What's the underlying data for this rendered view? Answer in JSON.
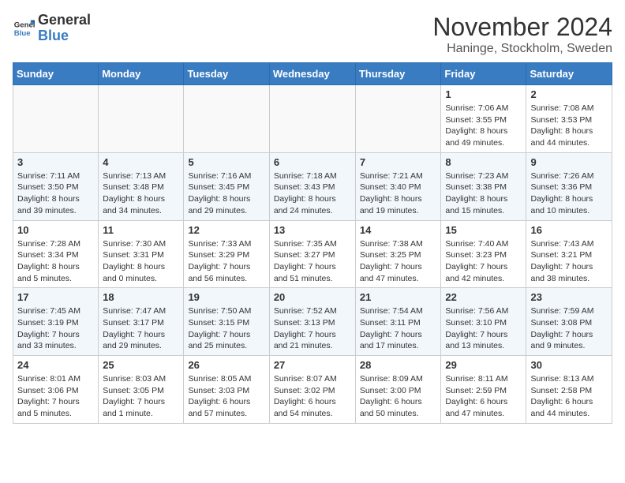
{
  "header": {
    "logo_general": "General",
    "logo_blue": "Blue",
    "month_title": "November 2024",
    "location": "Haninge, Stockholm, Sweden"
  },
  "weekdays": [
    "Sunday",
    "Monday",
    "Tuesday",
    "Wednesday",
    "Thursday",
    "Friday",
    "Saturday"
  ],
  "weeks": [
    {
      "days": [
        {
          "num": "",
          "info": ""
        },
        {
          "num": "",
          "info": ""
        },
        {
          "num": "",
          "info": ""
        },
        {
          "num": "",
          "info": ""
        },
        {
          "num": "",
          "info": ""
        },
        {
          "num": "1",
          "info": "Sunrise: 7:06 AM\nSunset: 3:55 PM\nDaylight: 8 hours and 49 minutes."
        },
        {
          "num": "2",
          "info": "Sunrise: 7:08 AM\nSunset: 3:53 PM\nDaylight: 8 hours and 44 minutes."
        }
      ]
    },
    {
      "days": [
        {
          "num": "3",
          "info": "Sunrise: 7:11 AM\nSunset: 3:50 PM\nDaylight: 8 hours and 39 minutes."
        },
        {
          "num": "4",
          "info": "Sunrise: 7:13 AM\nSunset: 3:48 PM\nDaylight: 8 hours and 34 minutes."
        },
        {
          "num": "5",
          "info": "Sunrise: 7:16 AM\nSunset: 3:45 PM\nDaylight: 8 hours and 29 minutes."
        },
        {
          "num": "6",
          "info": "Sunrise: 7:18 AM\nSunset: 3:43 PM\nDaylight: 8 hours and 24 minutes."
        },
        {
          "num": "7",
          "info": "Sunrise: 7:21 AM\nSunset: 3:40 PM\nDaylight: 8 hours and 19 minutes."
        },
        {
          "num": "8",
          "info": "Sunrise: 7:23 AM\nSunset: 3:38 PM\nDaylight: 8 hours and 15 minutes."
        },
        {
          "num": "9",
          "info": "Sunrise: 7:26 AM\nSunset: 3:36 PM\nDaylight: 8 hours and 10 minutes."
        }
      ]
    },
    {
      "days": [
        {
          "num": "10",
          "info": "Sunrise: 7:28 AM\nSunset: 3:34 PM\nDaylight: 8 hours and 5 minutes."
        },
        {
          "num": "11",
          "info": "Sunrise: 7:30 AM\nSunset: 3:31 PM\nDaylight: 8 hours and 0 minutes."
        },
        {
          "num": "12",
          "info": "Sunrise: 7:33 AM\nSunset: 3:29 PM\nDaylight: 7 hours and 56 minutes."
        },
        {
          "num": "13",
          "info": "Sunrise: 7:35 AM\nSunset: 3:27 PM\nDaylight: 7 hours and 51 minutes."
        },
        {
          "num": "14",
          "info": "Sunrise: 7:38 AM\nSunset: 3:25 PM\nDaylight: 7 hours and 47 minutes."
        },
        {
          "num": "15",
          "info": "Sunrise: 7:40 AM\nSunset: 3:23 PM\nDaylight: 7 hours and 42 minutes."
        },
        {
          "num": "16",
          "info": "Sunrise: 7:43 AM\nSunset: 3:21 PM\nDaylight: 7 hours and 38 minutes."
        }
      ]
    },
    {
      "days": [
        {
          "num": "17",
          "info": "Sunrise: 7:45 AM\nSunset: 3:19 PM\nDaylight: 7 hours and 33 minutes."
        },
        {
          "num": "18",
          "info": "Sunrise: 7:47 AM\nSunset: 3:17 PM\nDaylight: 7 hours and 29 minutes."
        },
        {
          "num": "19",
          "info": "Sunrise: 7:50 AM\nSunset: 3:15 PM\nDaylight: 7 hours and 25 minutes."
        },
        {
          "num": "20",
          "info": "Sunrise: 7:52 AM\nSunset: 3:13 PM\nDaylight: 7 hours and 21 minutes."
        },
        {
          "num": "21",
          "info": "Sunrise: 7:54 AM\nSunset: 3:11 PM\nDaylight: 7 hours and 17 minutes."
        },
        {
          "num": "22",
          "info": "Sunrise: 7:56 AM\nSunset: 3:10 PM\nDaylight: 7 hours and 13 minutes."
        },
        {
          "num": "23",
          "info": "Sunrise: 7:59 AM\nSunset: 3:08 PM\nDaylight: 7 hours and 9 minutes."
        }
      ]
    },
    {
      "days": [
        {
          "num": "24",
          "info": "Sunrise: 8:01 AM\nSunset: 3:06 PM\nDaylight: 7 hours and 5 minutes."
        },
        {
          "num": "25",
          "info": "Sunrise: 8:03 AM\nSunset: 3:05 PM\nDaylight: 7 hours and 1 minute."
        },
        {
          "num": "26",
          "info": "Sunrise: 8:05 AM\nSunset: 3:03 PM\nDaylight: 6 hours and 57 minutes."
        },
        {
          "num": "27",
          "info": "Sunrise: 8:07 AM\nSunset: 3:02 PM\nDaylight: 6 hours and 54 minutes."
        },
        {
          "num": "28",
          "info": "Sunrise: 8:09 AM\nSunset: 3:00 PM\nDaylight: 6 hours and 50 minutes."
        },
        {
          "num": "29",
          "info": "Sunrise: 8:11 AM\nSunset: 2:59 PM\nDaylight: 6 hours and 47 minutes."
        },
        {
          "num": "30",
          "info": "Sunrise: 8:13 AM\nSunset: 2:58 PM\nDaylight: 6 hours and 44 minutes."
        }
      ]
    }
  ]
}
